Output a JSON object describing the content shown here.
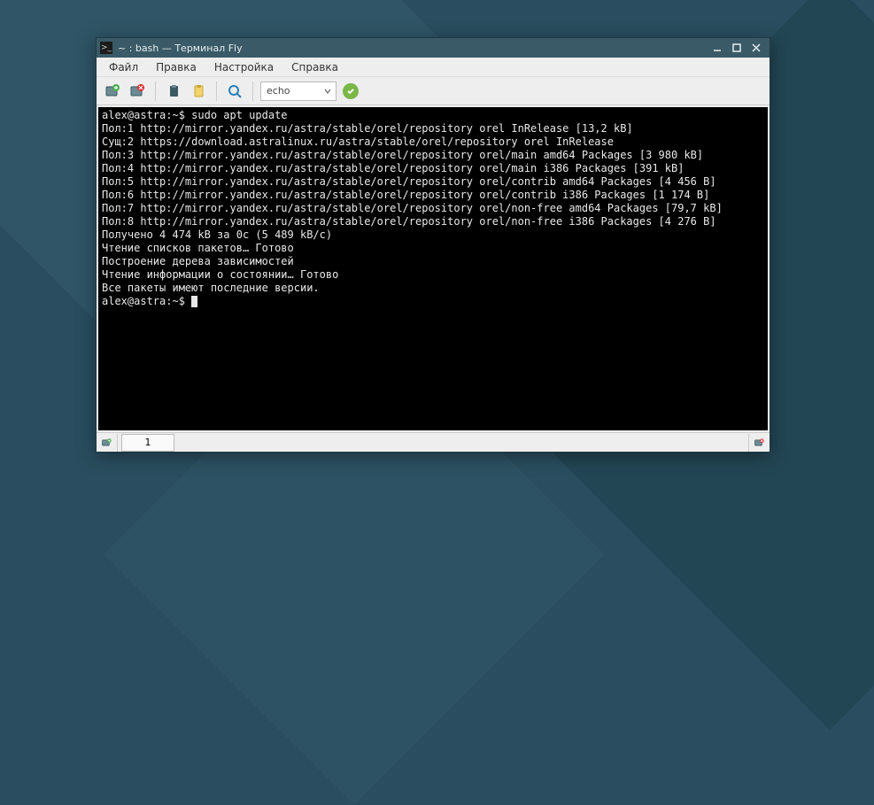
{
  "window": {
    "title": "~ : bash — Терминал Fly"
  },
  "menubar": {
    "items": [
      "Файл",
      "Правка",
      "Настройка",
      "Справка"
    ]
  },
  "toolbar": {
    "combo_value": "echo"
  },
  "terminal": {
    "prompt": "alex@astra:~$ ",
    "command": "sudo apt update",
    "lines": [
      "Пол:1 http://mirror.yandex.ru/astra/stable/orel/repository orel InRelease [13,2 kB]",
      "Сущ:2 https://download.astralinux.ru/astra/stable/orel/repository orel InRelease",
      "Пол:3 http://mirror.yandex.ru/astra/stable/orel/repository orel/main amd64 Packages [3 980 kB]",
      "Пол:4 http://mirror.yandex.ru/astra/stable/orel/repository orel/main i386 Packages [391 kB]",
      "Пол:5 http://mirror.yandex.ru/astra/stable/orel/repository orel/contrib amd64 Packages [4 456 B]",
      "Пол:6 http://mirror.yandex.ru/astra/stable/orel/repository orel/contrib i386 Packages [1 174 B]",
      "Пол:7 http://mirror.yandex.ru/astra/stable/orel/repository orel/non-free amd64 Packages [79,7 kB]",
      "Пол:8 http://mirror.yandex.ru/astra/stable/orel/repository orel/non-free i386 Packages [4 276 B]",
      "Получено 4 474 kB за 0с (5 489 kB/c)",
      "Чтение списков пакетов… Готово",
      "Построение дерева зависимостей",
      "Чтение информации о состоянии… Готово",
      "Все пакеты имеют последние версии."
    ],
    "prompt2": "alex@astra:~$ "
  },
  "statusbar": {
    "tab_label": "1"
  }
}
